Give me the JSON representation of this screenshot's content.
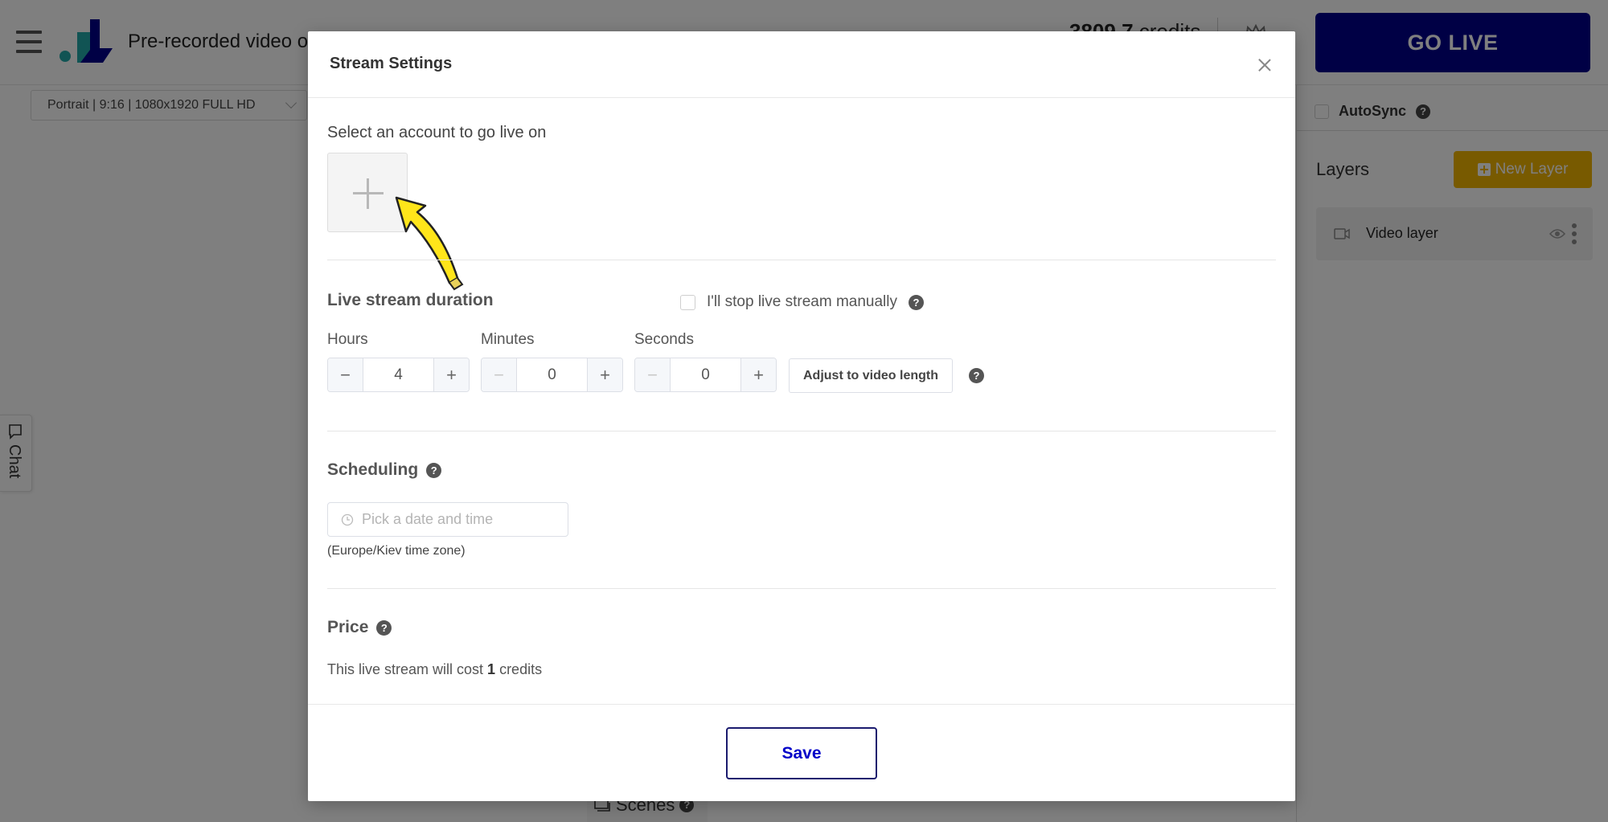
{
  "app": {
    "title": "Pre-recorded video o",
    "credits_amount": "3809.7",
    "credits_unit": "credits",
    "go_live_label": "GO LIVE",
    "format_select": "Portrait | 9:16 | 1080x1920 FULL HD",
    "chat_label": "Chat",
    "scenes_label": "Scenes",
    "colors": {
      "brand_blue": "#00008b",
      "accent_yellow": "#f0b400",
      "logo_teal": "#22a8a8"
    }
  },
  "right_panel": {
    "autosync_label": "AutoSync",
    "autosync_checked": false,
    "layers_title": "Layers",
    "new_layer_label": "New Layer",
    "layers": [
      {
        "name": "Video layer",
        "icon": "video-camera-icon",
        "visible": true
      }
    ]
  },
  "modal": {
    "title": "Stream Settings",
    "account_section_label": "Select an account to go live on",
    "duration": {
      "title": "Live stream duration",
      "manual_stop_label": "I'll stop live stream manually",
      "manual_stop_checked": false,
      "hours_label": "Hours",
      "hours_value": "4",
      "minutes_label": "Minutes",
      "minutes_value": "0",
      "seconds_label": "Seconds",
      "seconds_value": "0",
      "adjust_label": "Adjust to video length"
    },
    "scheduling": {
      "title": "Scheduling",
      "placeholder": "Pick a date and time",
      "timezone_note": "(Europe/Kiev time zone)"
    },
    "price": {
      "title": "Price",
      "prefix": "This live stream will cost ",
      "amount": "1",
      "suffix": " credits"
    },
    "save_label": "Save",
    "help_glyph": "?",
    "minus_glyph": "−",
    "plus_glyph": "+"
  }
}
